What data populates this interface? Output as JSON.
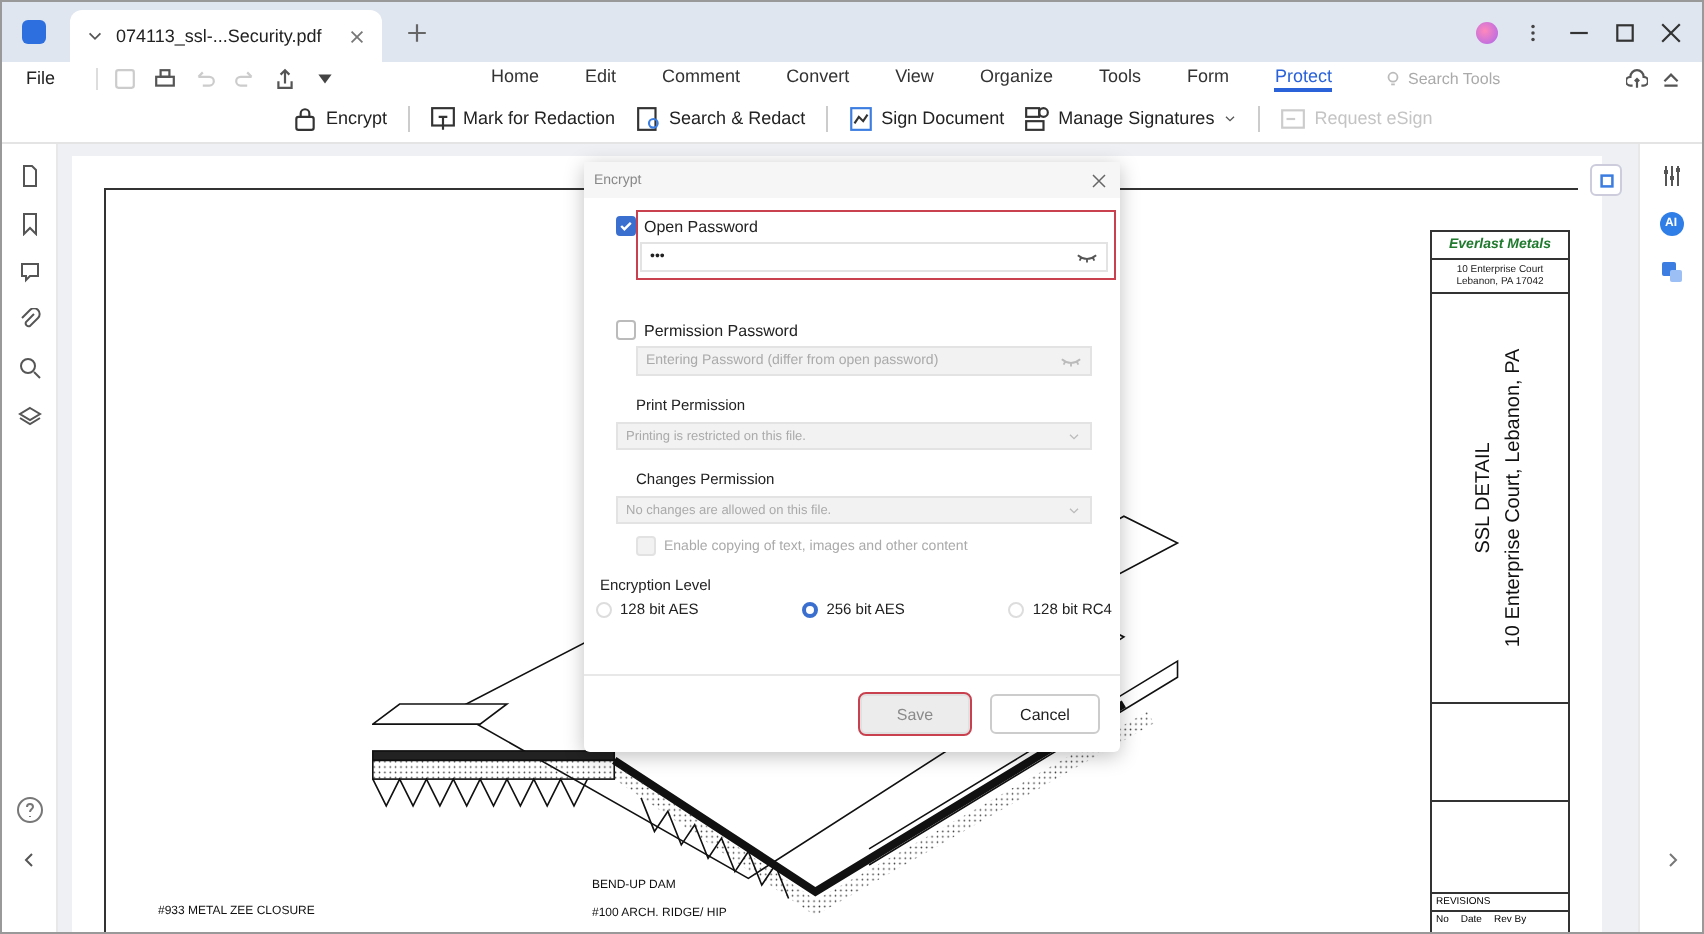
{
  "tab": {
    "title": "074113_ssl-...Security.pdf"
  },
  "menu": {
    "file": "File",
    "tabs": [
      {
        "label": "Home",
        "selected": false
      },
      {
        "label": "Edit",
        "selected": false
      },
      {
        "label": "Comment",
        "selected": false
      },
      {
        "label": "Convert",
        "selected": false
      },
      {
        "label": "View",
        "selected": false
      },
      {
        "label": "Organize",
        "selected": false
      },
      {
        "label": "Tools",
        "selected": false
      },
      {
        "label": "Form",
        "selected": false
      },
      {
        "label": "Protect",
        "selected": true
      }
    ],
    "search_tools": "Search Tools"
  },
  "toolbar": [
    {
      "kind": "lock",
      "label": "Encrypt",
      "disabled": false
    },
    {
      "kind": "redact",
      "label": "Mark for Redaction",
      "disabled": false
    },
    {
      "kind": "search",
      "label": "Search & Redact",
      "disabled": false
    },
    {
      "kind": "sign",
      "label": "Sign Document",
      "disabled": false
    },
    {
      "kind": "signatures",
      "label": "Manage Signatures",
      "disabled": false
    },
    {
      "kind": "esign",
      "label": "Request eSign",
      "disabled": true
    }
  ],
  "right_sidebar": {
    "ai": "AI"
  },
  "document": {
    "labels": [
      {
        "text": "#933 METAL ZEE CLOSURE"
      },
      {
        "text": "BEND-UP DAM"
      },
      {
        "text": "#100 ARCH. RIDGE/ HIP"
      }
    ],
    "title_block": {
      "logo": "Everlast Metals",
      "address_1": "10 Enterprise Court",
      "address_2": "Lebanon, PA 17042",
      "title": "SSL DETAIL",
      "subtitle": "10 Enterprise Court, Lebanon, PA",
      "revisions": "REVISIONS",
      "columns": [
        "No",
        "Date",
        "Rev By"
      ]
    }
  },
  "dialog": {
    "title": "Encrypt",
    "open_password": {
      "label": "Open Password",
      "checked": true,
      "value": "•••",
      "highlighted": true
    },
    "permission_password": {
      "label": "Permission Password",
      "checked": false,
      "placeholder": "Entering Password (differ from open password)"
    },
    "print_permission": {
      "label": "Print Permission",
      "value": "Printing is restricted on this file.",
      "disabled": true
    },
    "changes_permission": {
      "label": "Changes Permission",
      "value": "No changes are allowed on this file.",
      "disabled": true
    },
    "enable_copying": {
      "label": "Enable copying of text, images and other content",
      "checked": false,
      "disabled": true
    },
    "encryption_level": {
      "label": "Encryption Level",
      "options": [
        {
          "label": "128 bit AES",
          "selected": false
        },
        {
          "label": "256 bit AES",
          "selected": true
        },
        {
          "label": "128 bit RC4",
          "selected": false
        }
      ]
    },
    "buttons": [
      {
        "label": "Save",
        "disabled": true,
        "highlighted": true
      },
      {
        "label": "Cancel",
        "disabled": false,
        "highlighted": false
      }
    ]
  }
}
